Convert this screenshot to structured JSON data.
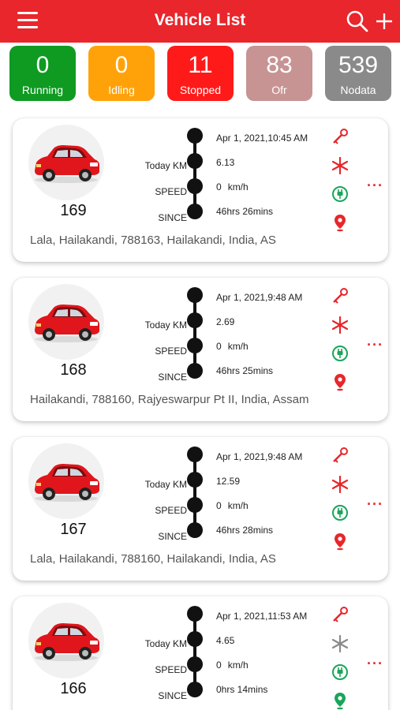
{
  "header": {
    "title": "Vehicle List"
  },
  "colors": {
    "brand": "#e8262b",
    "running": "#0f9a22",
    "idling": "#ffa20a",
    "stopped": "#ff1a1a",
    "ofr": "#c79393",
    "nodata": "#8a8a8a",
    "icon_green": "#1aa55a"
  },
  "status": [
    {
      "count": "0",
      "label": "Running"
    },
    {
      "count": "0",
      "label": "Idling"
    },
    {
      "count": "11",
      "label": "Stopped"
    },
    {
      "count": "83",
      "label": "Ofr"
    },
    {
      "count": "539",
      "label": "Nodata"
    }
  ],
  "labels": {
    "today_km": "Today KM",
    "speed": "SPEED",
    "since": "SINCE",
    "speed_unit": "km/h"
  },
  "icons": [
    "ignition-icon",
    "ac-icon",
    "power-plug-icon",
    "location-pin-icon",
    "more-options-icon",
    "menu-icon",
    "search-icon",
    "add-icon"
  ],
  "vehicles": [
    {
      "number": "169",
      "datetime": "Apr 1, 2021,10:45 AM",
      "today_km": "6.13",
      "speed": "0",
      "since": "46hrs 26mins",
      "address": "Lala, Hailakandi, 788163, Hailakandi, India, AS",
      "ac_on": true,
      "pin_color": "red"
    },
    {
      "number": "168",
      "datetime": "Apr 1, 2021,9:48 AM",
      "today_km": "2.69",
      "speed": "0",
      "since": "46hrs 25mins",
      "address": "Hailakandi, 788160, Rajyeswarpur Pt II, India, Assam",
      "ac_on": true,
      "pin_color": "red"
    },
    {
      "number": "167",
      "datetime": "Apr 1, 2021,9:48 AM",
      "today_km": "12.59",
      "speed": "0",
      "since": "46hrs 28mins",
      "address": "Lala, Hailakandi, 788160, Hailakandi, India, AS",
      "ac_on": true,
      "pin_color": "red"
    },
    {
      "number": "166",
      "datetime": "Apr 1, 2021,11:53 AM",
      "today_km": "4.65",
      "speed": "0",
      "since": "0hrs 14mins",
      "address": "",
      "ac_on": false,
      "pin_color": "green"
    }
  ]
}
